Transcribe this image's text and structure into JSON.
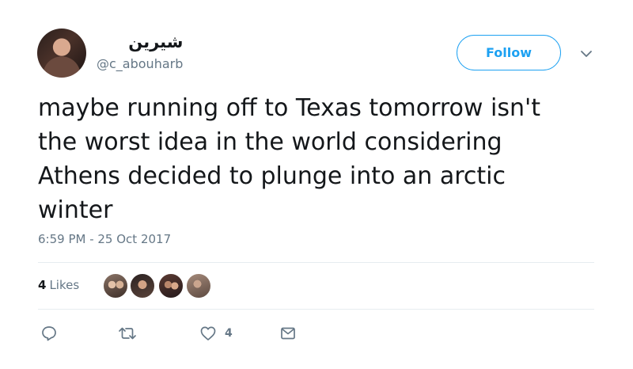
{
  "user": {
    "display_name": "شيرين",
    "handle": "@c_abouharb"
  },
  "follow_label": "Follow",
  "tweet": {
    "lines": [
      "maybe running off to Texas tomorrow isn't",
      "the worst idea in the world considering",
      "Athens decided to plunge into an arctic",
      "winter"
    ],
    "timestamp": "6:59 PM - 25 Oct 2017"
  },
  "likes": {
    "count": "4",
    "label": "Likes"
  },
  "actions": {
    "like_count": "4"
  },
  "colors": {
    "accent": "#1da1f2",
    "text_primary": "#14171a",
    "text_secondary": "#657786",
    "divider": "#e6ecf0"
  },
  "icons": [
    "chevron-down-icon",
    "reply-icon",
    "retweet-icon",
    "heart-icon",
    "message-icon"
  ]
}
